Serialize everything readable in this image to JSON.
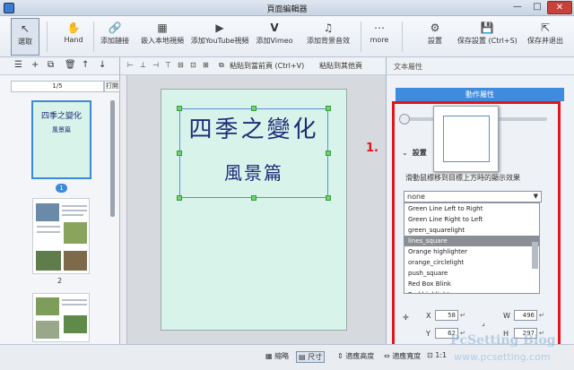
{
  "window": {
    "title": "頁面編輯器",
    "min": "—",
    "max": "□",
    "close": "✕"
  },
  "toolbar": {
    "select": {
      "icon": "select-arrow-icon",
      "label": "選取"
    },
    "hand": {
      "icon": "hand-icon",
      "label": "Hand"
    },
    "link": {
      "icon": "link-icon",
      "label": "添加鏈接"
    },
    "embed": {
      "icon": "film-icon",
      "label": "嵌入本地視頻"
    },
    "youtube": {
      "icon": "youtube-icon",
      "label": "添加YouTube視頻"
    },
    "vimeo": {
      "icon": "vimeo-icon",
      "label": "添加Vimeo"
    },
    "music": {
      "icon": "music-note-icon",
      "label": "添加背景音效"
    },
    "more": {
      "icon": "more-dots-icon",
      "label": "more"
    },
    "settings": {
      "icon": "gear-icon",
      "label": "設置"
    },
    "save": {
      "icon": "save-icon",
      "label": "保存設置 (Ctrl+S)"
    },
    "saveexit": {
      "icon": "save-exit-icon",
      "label": "保存并退出"
    }
  },
  "subbar": {
    "paste_prev": "粘貼到當前頁 (Ctrl+V)",
    "paste_other": "粘貼到其他頁"
  },
  "panel": {
    "header": "文本屬性",
    "anim_tab": "動作屬性",
    "settings_label": "設置",
    "hint": "滑動鼠標移到目標上方時的顯示效果",
    "select_value": "none",
    "list": [
      "Green Line Left to Right",
      "Green Line Right to Left",
      "green_squarelight",
      "lines_square",
      "Orange highlighter",
      "orange_circlelight",
      "push_square",
      "Red Box Blink",
      "Red highlighter"
    ],
    "selected_index": 3,
    "x_label": "X",
    "y_label": "Y",
    "w_label": "W",
    "h_label": "H",
    "x": "58",
    "y": "62",
    "w": "496",
    "h": "297"
  },
  "annotation": {
    "number": "1."
  },
  "thumbs": {
    "page_info": "1/5",
    "page_btn": "打開",
    "p1_title": "四季之變化",
    "p1_sub": "風景篇",
    "p1_num": "1",
    "p2_num": "2"
  },
  "page": {
    "title": "四季之變化",
    "subtitle": "風景篇"
  },
  "statusbar": {
    "thumb": "縮略",
    "actual": "尺寸",
    "fit_height": "適應高度",
    "fit_width": "適應寬度",
    "ratio": "1:1"
  },
  "watermark": {
    "line1": "PcSetting Blog",
    "line2": "www.pcsetting.com"
  }
}
